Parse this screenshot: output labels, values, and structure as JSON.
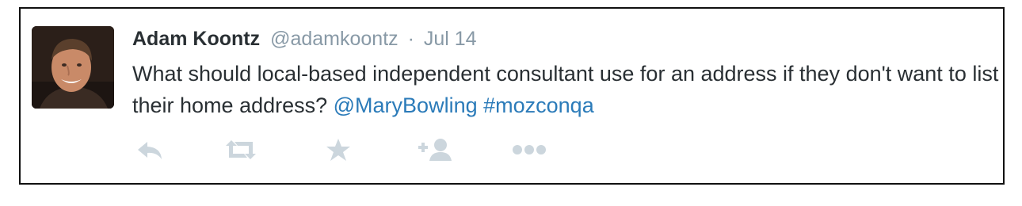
{
  "tweet": {
    "author_name": "Adam Koontz",
    "author_handle": "@adamkoontz",
    "separator": "·",
    "date": "Jul 14",
    "text_before": "What should local-based independent consultant use for an address if they don't want to list their home address? ",
    "mention": "@MaryBowling",
    "between": " ",
    "hashtag": "#mozconqa"
  },
  "actions": [
    {
      "icon": "reply-icon"
    },
    {
      "icon": "retweet-icon"
    },
    {
      "icon": "favorite-star-icon"
    },
    {
      "icon": "follow-user-icon"
    },
    {
      "icon": "more-ellipsis-icon"
    }
  ],
  "colors": {
    "text": "#292f33",
    "muted": "#8899a6",
    "link": "#2b7bb9",
    "action_icon": "#ccd6dd",
    "border": "#111111"
  }
}
